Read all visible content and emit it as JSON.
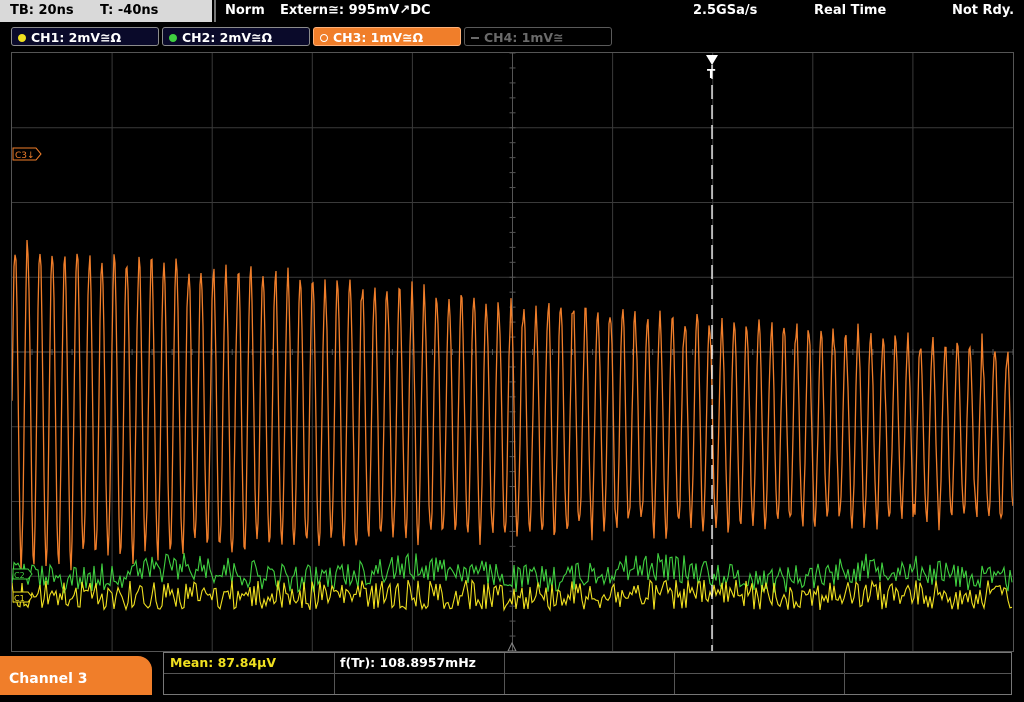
{
  "status": {
    "timebase": "TB: 20ns",
    "trigger_offset": "T: -40ns",
    "trigger_mode": "Norm",
    "trigger_source": "Extern≅: 995mV↗DC",
    "sample_rate": "2.5GSa/s",
    "acq_mode": "Real Time",
    "state": "Not Rdy."
  },
  "channels": [
    {
      "label": "CH1: 2mV≅Ω",
      "color": "#f0e020",
      "active": false,
      "enabled": true
    },
    {
      "label": "CH2: 2mV≅Ω",
      "color": "#40d040",
      "active": false,
      "enabled": true
    },
    {
      "label": "CH3: 1mV≅Ω",
      "color": "#f07e2a",
      "active": true,
      "enabled": true
    },
    {
      "label": "CH4: 1mV≅",
      "color": "#6a6a6a",
      "active": false,
      "enabled": false
    }
  ],
  "markers": {
    "ch3": "C3↓",
    "ch2": "C2",
    "ch1": "C1"
  },
  "bottom": {
    "selected_channel": "Channel 3",
    "mean": "Mean: 87.84µV",
    "frequency": "f(Tr): 108.8957mHz"
  },
  "colors": {
    "ch1": "#f0e020",
    "ch2": "#40d040",
    "ch3": "#f07e2a",
    "grid": "#3a3a3a",
    "trigger_line": "#ffffff"
  }
}
